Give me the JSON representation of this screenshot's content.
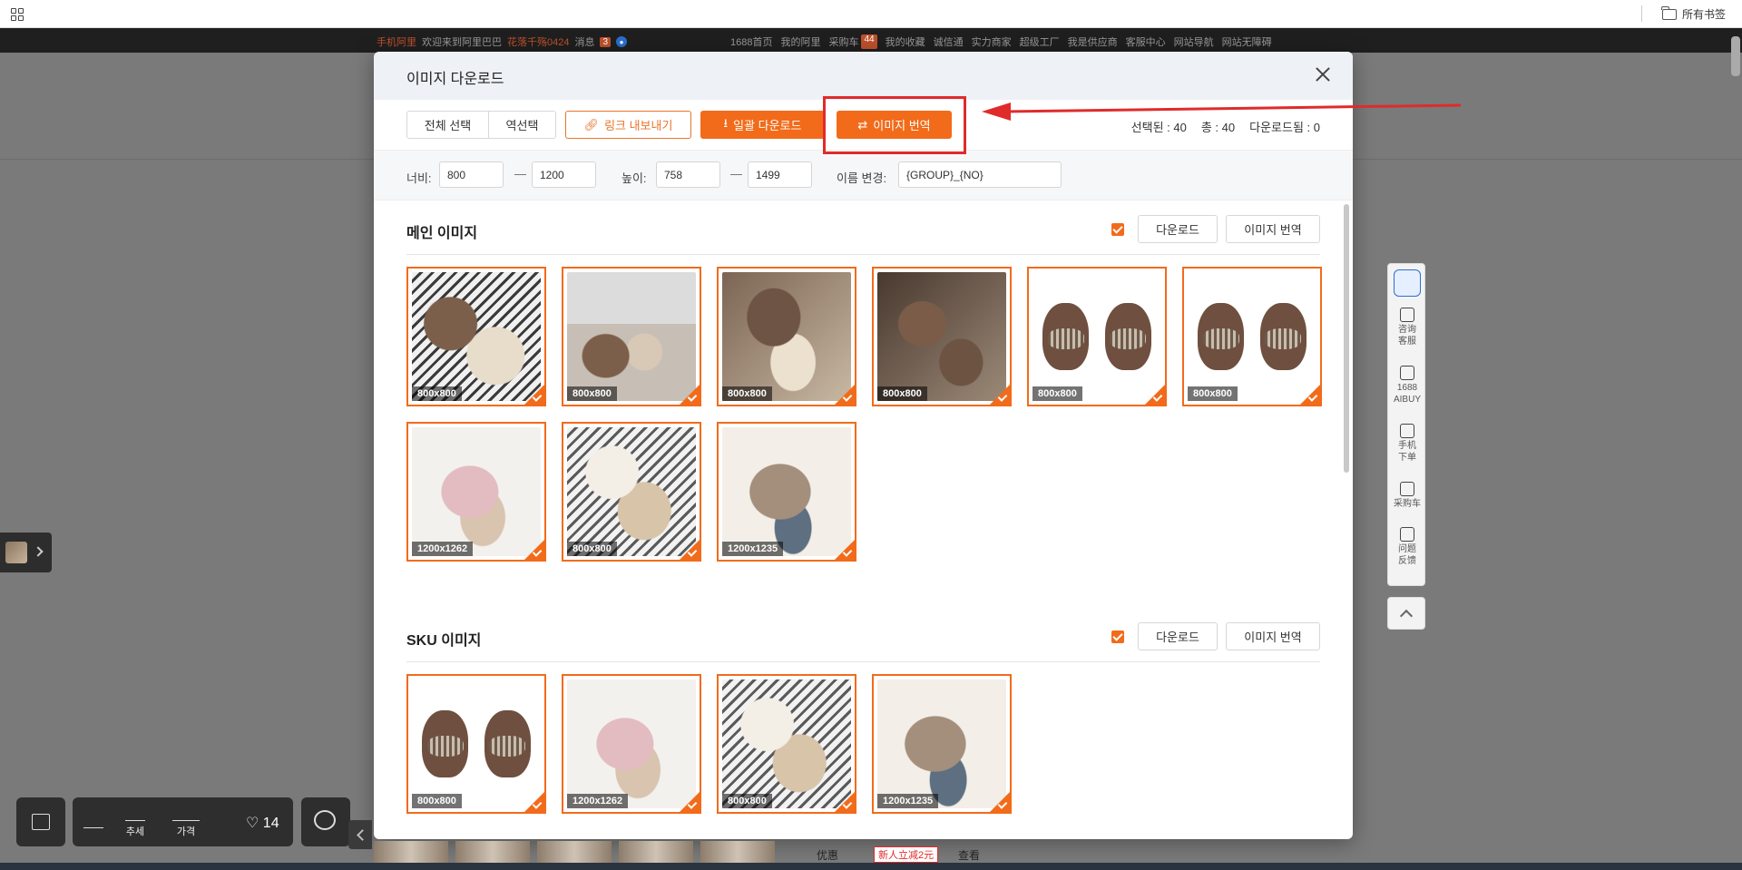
{
  "browser": {
    "bookmarks_label": "所有书签"
  },
  "topbar": {
    "left": {
      "mobile": "手机阿里",
      "welcome": "欢迎来到阿里巴巴",
      "user": "花落千殇0424",
      "messages_label": "消息",
      "messages_count": "3"
    },
    "right": [
      {
        "label": "1688首页"
      },
      {
        "label": "我的阿里"
      },
      {
        "label": "采购车",
        "badge": "44"
      },
      {
        "label": "我的收藏"
      },
      {
        "label": "诚信通"
      },
      {
        "label": "实力商家"
      },
      {
        "label": "超级工厂"
      },
      {
        "label": "我是供应商"
      },
      {
        "label": "客服中心"
      },
      {
        "label": "网站导航"
      },
      {
        "label": "网站无障碍"
      }
    ]
  },
  "modal": {
    "title": "이미지 다운로드",
    "toolbar": {
      "select_all": "전체 선택",
      "invert": "역선택",
      "export_link": "링크 내보내기",
      "bulk_download": "일괄 다운로드",
      "translate": "이미지 번역"
    },
    "stats": {
      "selected": "선택된 : 40",
      "total": "총 : 40",
      "downloaded": "다운로드됨 : 0"
    },
    "filters": {
      "width_label": "너비:",
      "width_min": "800",
      "width_max": "1200",
      "height_label": "높이:",
      "height_min": "758",
      "height_max": "1499",
      "rename_label": "이름 변경:",
      "rename_value": "{GROUP}_{NO}",
      "dash": "—"
    },
    "sections": [
      {
        "title": "메인 이미지",
        "download": "다운로드",
        "translate": "이미지 번역",
        "images": [
          {
            "size": "800x800",
            "style": "a"
          },
          {
            "size": "800x800",
            "style": "b"
          },
          {
            "size": "800x800",
            "style": "c"
          },
          {
            "size": "800x800",
            "style": "d"
          },
          {
            "size": "800x800",
            "style": "e"
          },
          {
            "size": "800x800",
            "style": "e"
          },
          {
            "size": "1200x1262",
            "style": "f"
          },
          {
            "size": "800x800",
            "style": "g"
          },
          {
            "size": "1200x1235",
            "style": "h"
          }
        ]
      },
      {
        "title": "SKU 이미지",
        "download": "다운로드",
        "translate": "이미지 번역",
        "images": [
          {
            "size": "800x800",
            "style": "e"
          },
          {
            "size": "1200x1262",
            "style": "f"
          },
          {
            "size": "800x800",
            "style": "g"
          },
          {
            "size": "1200x1235",
            "style": "h"
          }
        ]
      }
    ]
  },
  "right_panel": {
    "items": [
      {
        "label": "咨询\n客服"
      },
      {
        "label": "1688\nAIBUY"
      },
      {
        "label": "手机\n下单"
      },
      {
        "label": "采购车"
      },
      {
        "label": "问题\n反馈"
      }
    ]
  },
  "bottom_bar": {
    "trend": "추세",
    "price": "가격",
    "favorites": "14"
  },
  "page_strip": {
    "discount_label": "优惠",
    "coupon": "新人立减2元",
    "view": "查看"
  }
}
